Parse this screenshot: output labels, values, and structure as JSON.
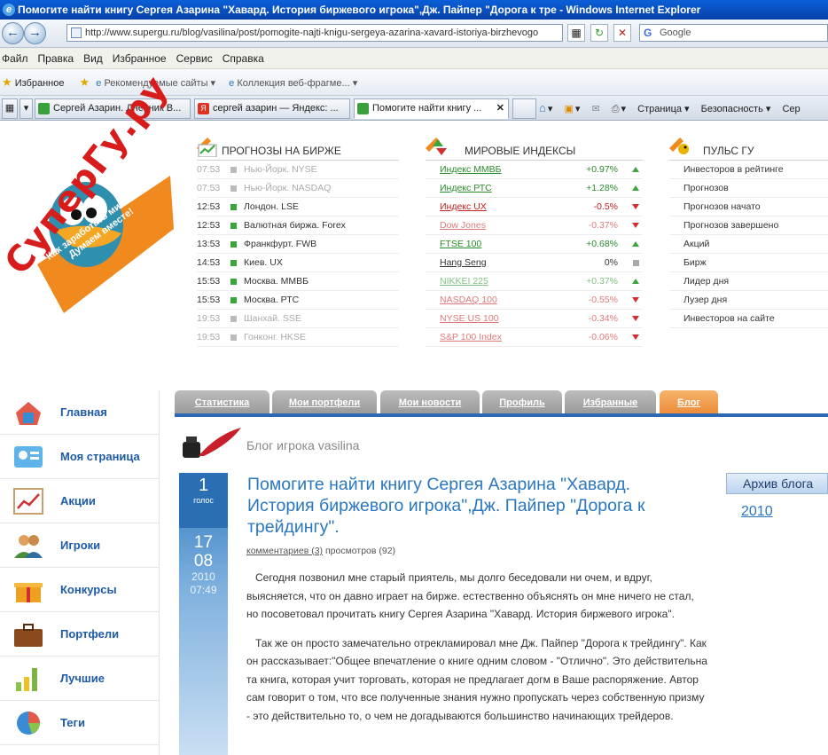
{
  "browser": {
    "window_title": "Помогите найти книгу Сергея Азарина \"Хавард. История биржевого игрока\",Дж. Пайпер \"Дорога к тре - Windows Internet Explorer",
    "address": "http://www.supergu.ru/blog/vasilina/post/pomogite-najti-knigu-sergeya-azarina-xavard-istoriya-birzhevogo",
    "search_placeholder": "Google",
    "menu": [
      "Файл",
      "Правка",
      "Вид",
      "Избранное",
      "Сервис",
      "Справка"
    ],
    "favorites_label": "Избранное",
    "fav_links": [
      "Рекомендуемые сайты ▾",
      "Коллекция веб-фрагме... ▾"
    ],
    "tabs": [
      "Сергей Азарин. Дневник В...",
      "сергей азарин — Яндекс: ...",
      "Помогите найти книгу ..."
    ],
    "commands": [
      "Страница ▾",
      "Безопасность ▾",
      "Сер"
    ]
  },
  "logo_text": "СуперГу.ру",
  "logo_slogan": [
    "Как заработать миллион?",
    "Думаем вместе!"
  ],
  "forecasts": {
    "title": "ПРОГНОЗЫ НА БИРЖЕ",
    "rows": [
      {
        "time": "07:53",
        "market": "Нью-Йорк. NYSE",
        "dim": true
      },
      {
        "time": "07:53",
        "market": "Нью-Йорк. NASDAQ",
        "dim": true
      },
      {
        "time": "12:53",
        "market": "Лондон. LSE",
        "dim": false
      },
      {
        "time": "12:53",
        "market": "Валютная биржа. Forex",
        "dim": false
      },
      {
        "time": "13:53",
        "market": "Франкфурт. FWB",
        "dim": false
      },
      {
        "time": "14:53",
        "market": "Киев. UX",
        "dim": false
      },
      {
        "time": "15:53",
        "market": "Москва. ММВБ",
        "dim": false
      },
      {
        "time": "15:53",
        "market": "Москва. РТС",
        "dim": false
      },
      {
        "time": "19:53",
        "market": "Шанхай. SSE",
        "dim": true
      },
      {
        "time": "19:53",
        "market": "Гонконг. HKSE",
        "dim": true
      }
    ]
  },
  "indices": {
    "title": "МИРОВЫЕ ИНДЕКСЫ",
    "rows": [
      {
        "name": "Индекс ММВБ",
        "change": "+0.97%",
        "dir": "up",
        "color": "#2b8a2b"
      },
      {
        "name": "Индекс РТС",
        "change": "+1.28%",
        "dir": "up",
        "color": "#2b8a2b"
      },
      {
        "name": "Индекс UX",
        "change": "-0.5%",
        "dir": "down",
        "color": "#c42020"
      },
      {
        "name": "Dow Jones",
        "change": "-0.37%",
        "dir": "down",
        "color": "#e07a7a"
      },
      {
        "name": "FTSE 100",
        "change": "+0.68%",
        "dir": "up",
        "color": "#2b8a2b"
      },
      {
        "name": "Hang Seng",
        "change": "0%",
        "dir": "flat",
        "color": "#333333"
      },
      {
        "name": "NIKKEI 225",
        "change": "+0.37%",
        "dir": "up",
        "color": "#7fc27f"
      },
      {
        "name": "NASDAQ 100",
        "change": "-0.55%",
        "dir": "down",
        "color": "#e07a7a"
      },
      {
        "name": "NYSE US 100",
        "change": "-0.34%",
        "dir": "down",
        "color": "#e07a7a"
      },
      {
        "name": "S&P 100 Index",
        "change": "-0.06%",
        "dir": "down",
        "color": "#e07a7a"
      }
    ]
  },
  "pulse": {
    "title": "ПУЛЬС ГУ",
    "rows": [
      "Инвесторов в рейтинге",
      "Прогнозов",
      "Прогнозов начато",
      "Прогнозов завершено",
      "Акций",
      "Бирж",
      "Лидер дня",
      "Лузер дня",
      "Инвесторов на сайте"
    ]
  },
  "sidenav": [
    "Главная",
    "Моя страница",
    "Акции",
    "Игроки",
    "Конкурсы",
    "Портфели",
    "Лучшие",
    "Теги"
  ],
  "content_tabs": [
    {
      "label": "Статистика",
      "active": false
    },
    {
      "label": "Мои портфели",
      "active": false
    },
    {
      "label": "Мои новости",
      "active": false
    },
    {
      "label": "Профиль",
      "active": false
    },
    {
      "label": "Избранные",
      "active": false
    },
    {
      "label": "Блог",
      "active": true
    }
  ],
  "blog": {
    "title": "Блог игрока vasilina",
    "vote_count": "1",
    "vote_label": "голос",
    "day": "17",
    "month": "08",
    "year": "2010",
    "time": "07:49",
    "post_title": "Помогите найти книгу Сергея Азарина \"Хавард. История биржевого игрока\",Дж. Пайпер \"Дорога к трейдингу\".",
    "comments": "комментариев (3)",
    "views": " просмотров (92)",
    "paragraphs": [
      "Сегодня позвонил мне старый приятель, мы долго беседовали ни очем, и вдруг, выясняется, что он давно играет на бирже. естественно объяснять он мне ничего не стал, но посоветовал прочитать книгу Сергея Азарина \"Хавард. История биржевого игрока\".",
      "Так же он просто замечательно отрекламировал мне Дж. Пайпер \"Дорога к трейдингу\". Как он рассказывает:\"Общее впечатление о книге одним словом - \"Отлично\". Это действительна та книга, которая учит торговать, которая не предлагает догм в Ваше распоряжение. Автор сам говорит о том, что все полученные знания нужно пропускать через собственную призму - это действительно то, о чем не догадываются большинство начинающих трейдеров."
    ],
    "archive_title": "Архив блога",
    "archive_year": "2010"
  }
}
